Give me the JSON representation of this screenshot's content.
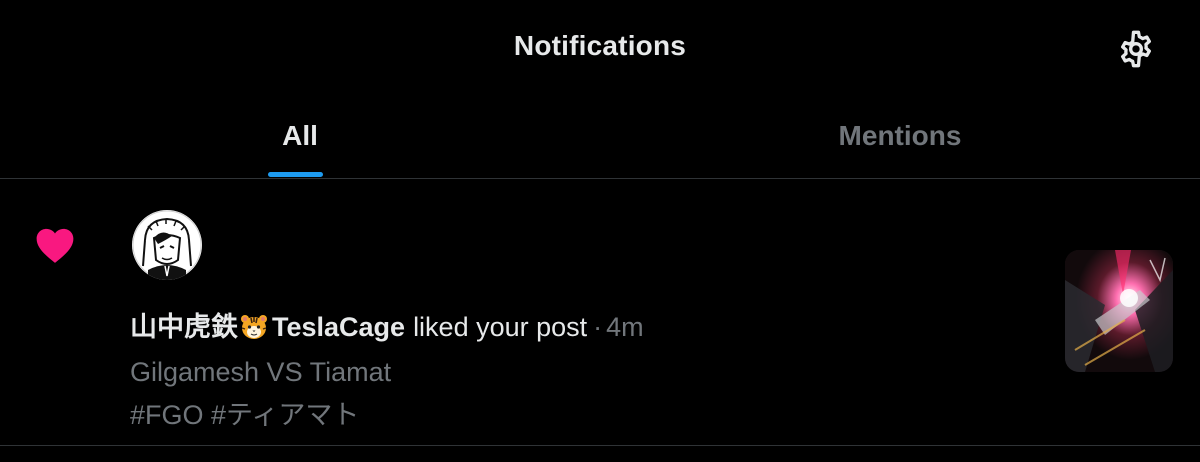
{
  "header": {
    "title": "Notifications",
    "settings_icon": "gear-icon"
  },
  "tabs": [
    {
      "label": "All",
      "selected": true
    },
    {
      "label": "Mentions",
      "selected": false
    }
  ],
  "notification": {
    "type_icon": "heart-icon",
    "user_name": "山中虎鉄",
    "user_emoji": "tiger-face-icon",
    "user_name_suffix": "TeslaCage",
    "action": "liked your post",
    "separator": "·",
    "time": "4m",
    "post_line1": "Gilgamesh VS Tiamat",
    "post_line2": "#FGO #ティアマト"
  },
  "colors": {
    "background": "#000000",
    "text_primary": "#e7e9ea",
    "text_secondary": "#71767b",
    "accent": "#1d9bf0",
    "like": "#f91880",
    "divider": "#2f3336"
  }
}
